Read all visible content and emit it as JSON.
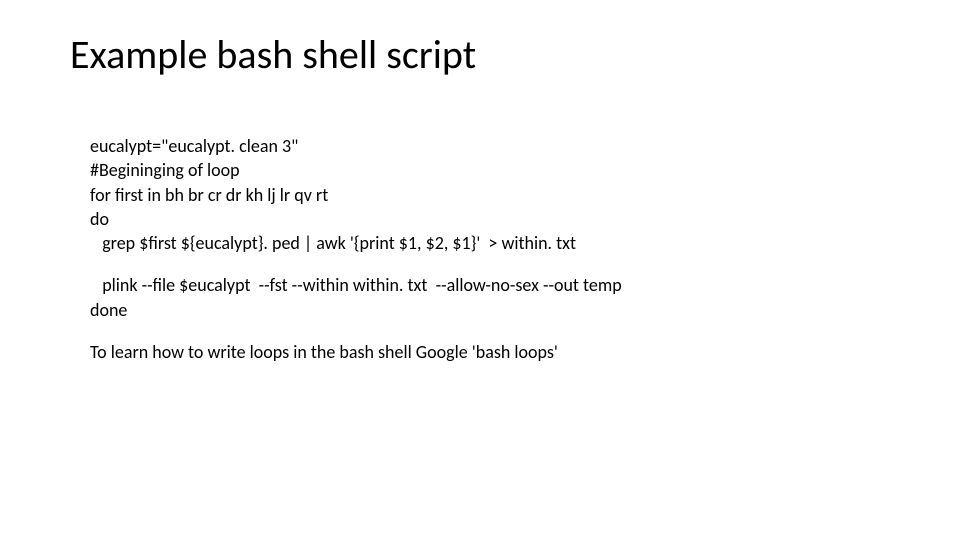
{
  "title": "Example bash shell script",
  "code": {
    "line1": "eucalypt=\"eucalypt. clean 3\"",
    "line2": "#Begininging of loop",
    "line3": "for first in bh br cr dr kh lj lr qv rt",
    "line4": "do",
    "line5": "   grep $first ${eucalypt}. ped | awk '{print $1, $2, $1}'  > within. txt",
    "line6": "   plink --file $eucalypt  --fst --within within. txt  --allow-no-sex --out temp",
    "line7": "done"
  },
  "learn": "To learn how to write loops in the bash shell Google 'bash loops'"
}
